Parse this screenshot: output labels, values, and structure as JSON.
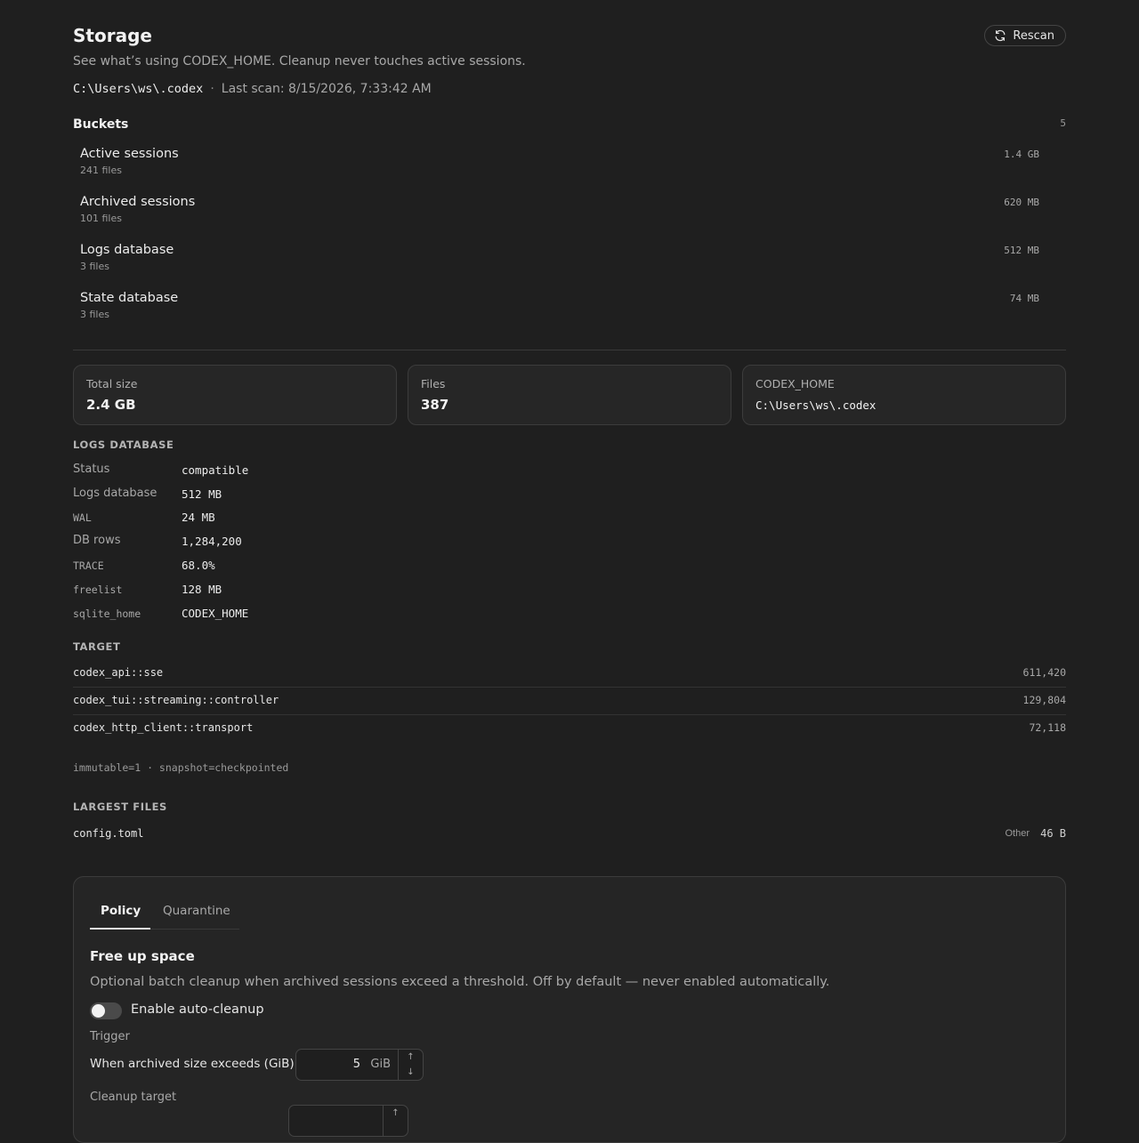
{
  "header": {
    "title": "Storage",
    "subtitle": "See what’s using CODEX_HOME. Cleanup never touches active sessions.",
    "path": "C:\\Users\\ws\\.codex",
    "separator": "·",
    "last_scan": "Last scan: 8/15/2026, 7:33:42 AM",
    "rescan_label": "Rescan"
  },
  "buckets": {
    "title": "Buckets",
    "count": "5",
    "items": [
      {
        "name": "Active sessions",
        "files": "241 files",
        "size": "1.4 GB"
      },
      {
        "name": "Archived sessions",
        "files": "101 files",
        "size": "620 MB"
      },
      {
        "name": "Logs database",
        "files": "3 files",
        "size": "512 MB"
      },
      {
        "name": "State database",
        "files": "3 files",
        "size": "74 MB"
      }
    ]
  },
  "stats": [
    {
      "label": "Total size",
      "value": "2.4 GB"
    },
    {
      "label": "Files",
      "value": "387"
    },
    {
      "label": "CODEX_HOME",
      "value": "C:\\Users\\ws\\.codex"
    }
  ],
  "logs_database": {
    "heading": "LOGS DATABASE",
    "rows": [
      {
        "key": "Status",
        "value": "compatible"
      },
      {
        "key": "Logs database",
        "value": "512 MB"
      },
      {
        "key": "WAL",
        "value": "24 MB"
      },
      {
        "key": "DB rows",
        "value": "1,284,200"
      },
      {
        "key": "TRACE",
        "value": "68.0%"
      },
      {
        "key": "freelist",
        "value": "128 MB"
      },
      {
        "key": "sqlite_home",
        "value": "CODEX_HOME"
      }
    ]
  },
  "target": {
    "heading": "TARGET",
    "rows": [
      {
        "name": "codex_api::sse",
        "count": "611,420"
      },
      {
        "name": "codex_tui::streaming::controller",
        "count": "129,804"
      },
      {
        "name": "codex_http_client::transport",
        "count": "72,118"
      }
    ],
    "footnote": "immutable=1 · snapshot=checkpointed"
  },
  "largest_files": {
    "heading": "LARGEST FILES",
    "items": [
      {
        "name": "config.toml",
        "category": "Other",
        "size": "46 B"
      }
    ]
  },
  "policy": {
    "tabs": [
      "Policy",
      "Quarantine"
    ],
    "active_tab": "Policy",
    "section_title": "Free up space",
    "description": "Optional batch cleanup when archived sessions exceed a threshold. Off by default — never enabled automatically.",
    "toggle_label": "Enable auto-cleanup",
    "toggle_on": false,
    "trigger_label": "Trigger",
    "trigger_desc": "When archived size exceeds (GiB)",
    "trigger_value": "5",
    "trigger_unit": "GiB",
    "cleanup_target_label": "Cleanup target"
  },
  "icons": {
    "rescan": "refresh-icon",
    "step_up": "arrow-up-icon",
    "step_down": "arrow-down-icon"
  },
  "colors": {
    "background": "#1f1f1f",
    "card": "#262626",
    "border": "#3c3c3c",
    "text": "#e6e6e6",
    "muted": "#a8a8a8"
  }
}
